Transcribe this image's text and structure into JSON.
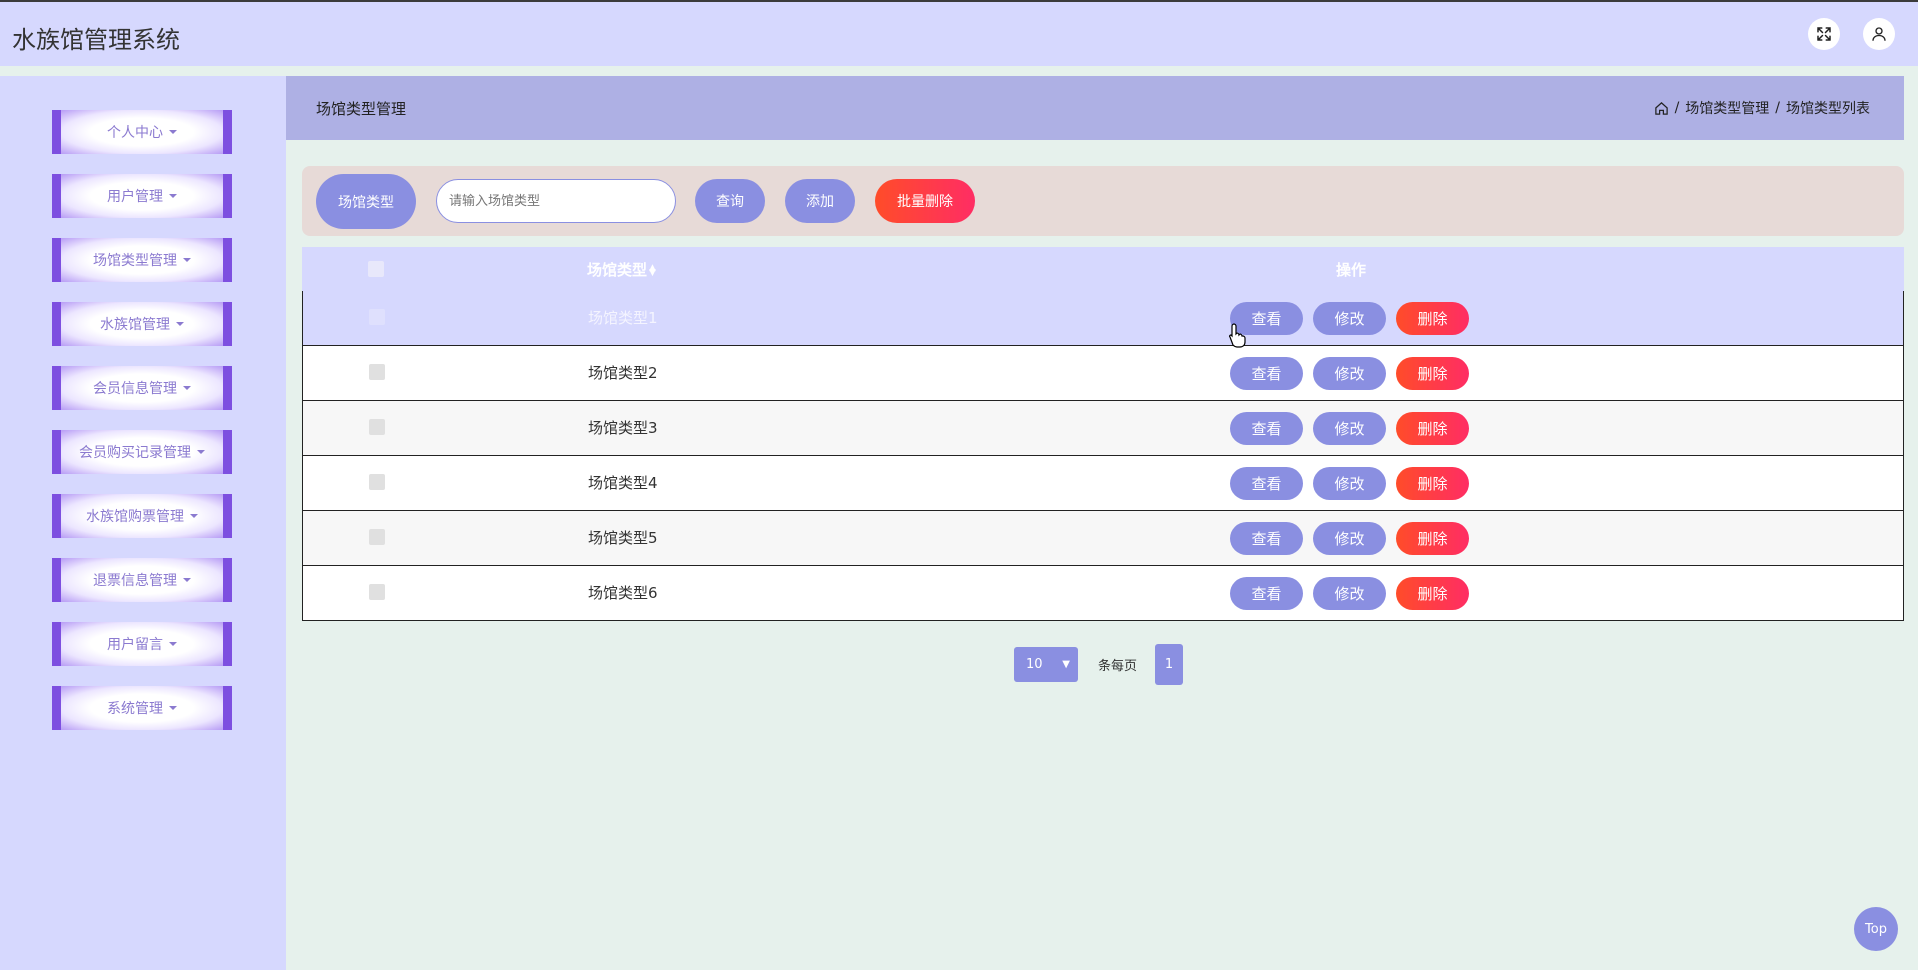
{
  "header": {
    "title": "水族馆管理系统",
    "fullscreen_icon": "expand-icon",
    "user_icon": "user-icon"
  },
  "sidebar": {
    "items": [
      {
        "label": "个人中心"
      },
      {
        "label": "用户管理"
      },
      {
        "label": "场馆类型管理"
      },
      {
        "label": "水族馆管理"
      },
      {
        "label": "会员信息管理"
      },
      {
        "label": "会员购买记录管理"
      },
      {
        "label": "水族馆购票管理"
      },
      {
        "label": "退票信息管理"
      },
      {
        "label": "用户留言"
      },
      {
        "label": "系统管理"
      }
    ]
  },
  "content": {
    "title": "场馆类型管理",
    "breadcrumb": {
      "home_icon": "home-icon",
      "items": [
        "场馆类型管理",
        "场馆类型列表"
      ],
      "separator": "/"
    }
  },
  "search": {
    "label": "场馆类型",
    "placeholder": "请输入场馆类型",
    "value": "",
    "query_label": "查询",
    "add_label": "添加",
    "batch_delete_label": "批量删除"
  },
  "table": {
    "headers": {
      "name": "场馆类型",
      "sort_icon": "sort-icon",
      "actions": "操作"
    },
    "rows": [
      {
        "name": "场馆类型1"
      },
      {
        "name": "场馆类型2"
      },
      {
        "name": "场馆类型3"
      },
      {
        "name": "场馆类型4"
      },
      {
        "name": "场馆类型5"
      },
      {
        "name": "场馆类型6"
      }
    ],
    "actions": {
      "view": "查看",
      "edit": "修改",
      "delete": "删除"
    }
  },
  "pagination": {
    "page_size": "10",
    "per_page_label": "条每页",
    "current_page": "1"
  },
  "back_to_top": "Top",
  "colors": {
    "accent": "#8a8fe1",
    "danger": "#ff3b3b",
    "sidebar_bg": "#d6d8fe",
    "content_bg": "#e6f1ec"
  }
}
